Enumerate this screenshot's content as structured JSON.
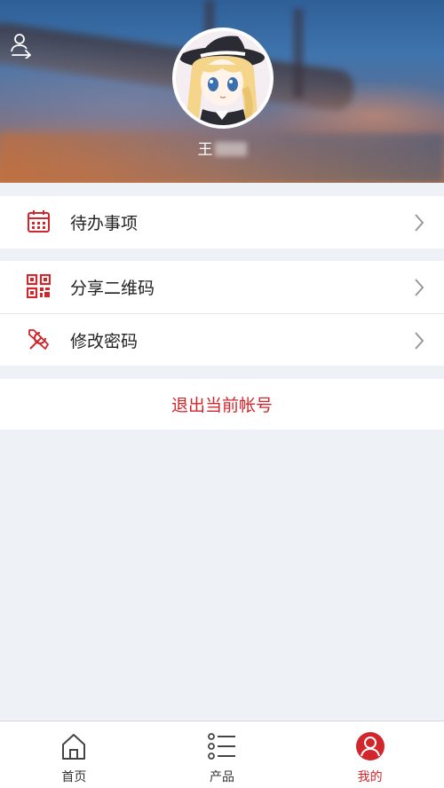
{
  "header": {
    "username_visible": "王"
  },
  "menu_group_1": [
    {
      "label": "待办事项",
      "icon": "calendar-icon"
    }
  ],
  "menu_group_2": [
    {
      "label": "分享二维码",
      "icon": "qr-code-icon"
    },
    {
      "label": "修改密码",
      "icon": "tools-icon"
    }
  ],
  "logout": {
    "label": "退出当前帐号"
  },
  "tabbar": [
    {
      "label": "首页",
      "icon": "home-icon",
      "active": false
    },
    {
      "label": "产品",
      "icon": "list-icon",
      "active": false
    },
    {
      "label": "我的",
      "icon": "user-icon",
      "active": true
    }
  ],
  "colors": {
    "accent": "#d0262c",
    "background": "#eef1f5"
  }
}
